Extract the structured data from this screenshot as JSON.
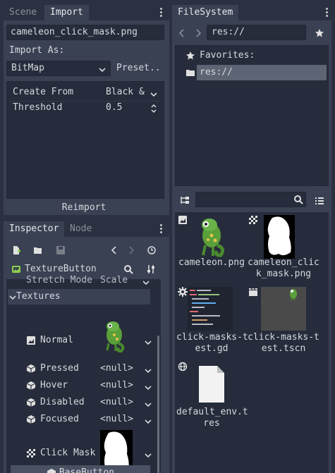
{
  "import_dock": {
    "tabs": [
      "Scene",
      "Import"
    ],
    "file_name": "cameleon_click_mask.png",
    "import_as_label": "Import As:",
    "import_as_value": "BitMap",
    "preset_label": "Preset..",
    "properties": [
      {
        "label": "Create From",
        "value": "Black &"
      },
      {
        "label": "Threshold",
        "value": "0.5"
      }
    ],
    "reimport_label": "Reimport"
  },
  "filesystem": {
    "tab": "FileSystem",
    "path": "res://",
    "tree": [
      {
        "label": "Favorites:",
        "icon": "star-icon"
      },
      {
        "label": "res://",
        "icon": "folder-icon",
        "selected": true
      }
    ],
    "files": [
      {
        "name": "cameleon.png",
        "icon": "image-icon"
      },
      {
        "name": "cameleon_clic\nk_mask.png",
        "icon": "bitmap-icon"
      },
      {
        "name": "click-masks-t\nest.gd",
        "icon": "script-gear-icon"
      },
      {
        "name": "click-masks-t\nest.tscn",
        "icon": "scene-icon"
      },
      {
        "name": "default_env.t\nres",
        "icon": "environment-icon"
      }
    ]
  },
  "inspector": {
    "tabs": [
      "Inspector",
      "Node"
    ],
    "node_name": "TextureButton",
    "cut_row": {
      "label": "Stretch Mode",
      "value": "Scale"
    },
    "section": "Textures",
    "props": [
      {
        "label": "Normal",
        "value": ""
      },
      {
        "label": "Pressed",
        "value": "<null>"
      },
      {
        "label": "Hover",
        "value": "<null>"
      },
      {
        "label": "Disabled",
        "value": "<null>"
      },
      {
        "label": "Focused",
        "value": "<null>"
      },
      {
        "label": "Click Mask",
        "value": ""
      }
    ],
    "footer": "BaseButton"
  },
  "colors": {
    "background": "#2b3141",
    "panel": "#3a4153",
    "field": "#262c3b",
    "accent": "#699ce8",
    "chameleon": "#5aa03a"
  }
}
